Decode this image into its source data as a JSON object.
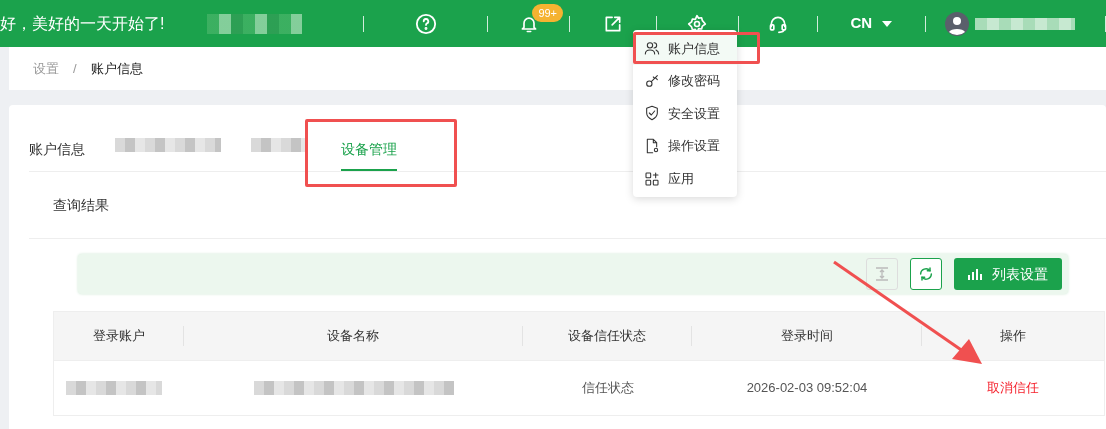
{
  "header": {
    "greeting": "好，美好的一天开始了!",
    "notification_badge": "99+",
    "language": "CN"
  },
  "settings_menu": {
    "items": [
      {
        "kind": "users",
        "label": "账户信息",
        "selected": true
      },
      {
        "kind": "key",
        "label": "修改密码",
        "selected": false
      },
      {
        "kind": "shield",
        "label": "安全设置",
        "selected": false
      },
      {
        "kind": "file",
        "label": "操作设置",
        "selected": false
      },
      {
        "kind": "apps",
        "label": "应用",
        "selected": false
      }
    ]
  },
  "breadcrumb": [
    "设置",
    "/",
    "账户信息"
  ],
  "tabs": [
    {
      "kind": "text",
      "label": "账户信息",
      "selected": false
    },
    {
      "kind": "blurred",
      "selected": false
    },
    {
      "kind": "blurred",
      "selected": false
    },
    {
      "kind": "text",
      "label": "设备管理",
      "selected": true
    }
  ],
  "section_title": "查询结果",
  "toolbar": {
    "list_settings": "列表设置"
  },
  "table": {
    "columns": [
      "登录账户",
      "设备名称",
      "设备信任状态",
      "登录时间",
      "操作"
    ],
    "rows": [
      {
        "trust_status": "信任状态",
        "login_time": "2026-02-03 09:52:04",
        "action": "取消信任"
      }
    ]
  }
}
